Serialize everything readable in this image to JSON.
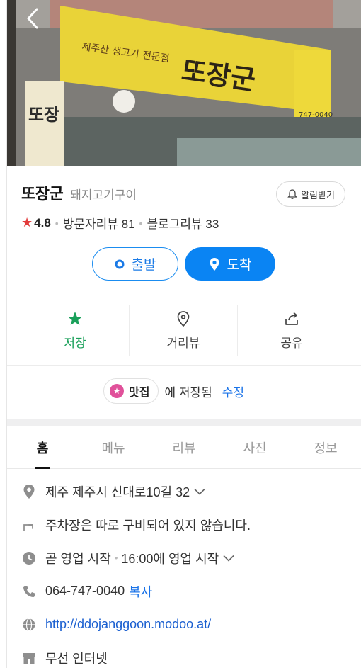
{
  "header": {
    "back_icon": "chevron-left-icon"
  },
  "hero": {
    "sign_main": "또장군",
    "sign_sub": "제주산 생고기 전문점",
    "sign_phone": "747-0040",
    "side_sign": "또장",
    "side_sign_right": "또장군"
  },
  "place": {
    "name": "또장군",
    "category": "돼지고기구이",
    "alarm_label": "알림받기",
    "rating": "4.8",
    "visitor_reviews": "방문자리뷰 81",
    "blog_reviews": "블로그리뷰 33"
  },
  "route": {
    "start_label": "출발",
    "arrive_label": "도착"
  },
  "actions": [
    {
      "label": "저장",
      "icon": "star-icon"
    },
    {
      "label": "거리뷰",
      "icon": "map-pin-outline-icon"
    },
    {
      "label": "공유",
      "icon": "share-icon"
    }
  ],
  "saved": {
    "chip_label": "맛집",
    "text": "에 저장됨",
    "edit_label": "수정"
  },
  "tabs": [
    "홈",
    "메뉴",
    "리뷰",
    "사진",
    "정보"
  ],
  "info": {
    "address": "제주 제주시 신대로10길 32",
    "parking": "주차장은 따로 구비되어 있지 않습니다.",
    "hours_status": "곧 영업 시작",
    "hours_detail": "16:00에 영업 시작",
    "phone": "064-747-0040",
    "copy_label": "복사",
    "website": "http://ddojanggoon.modoo.at/",
    "wifi": "무선 인터넷"
  },
  "colors": {
    "accent_blue": "#0a84f3",
    "save_green": "#1aa05a",
    "star_red": "#e23c3c",
    "chip_pink": "#e0519a"
  }
}
